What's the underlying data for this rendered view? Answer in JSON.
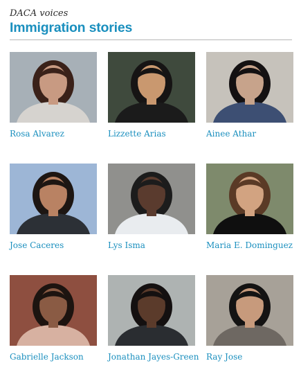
{
  "header": {
    "kicker": "DACA voices",
    "title": "Immigration stories"
  },
  "stories": [
    {
      "name": "Rosa Alvarez",
      "bg": "#a7b0b7",
      "skin": "#c89a82",
      "hair": "#3a2119",
      "shirt": "#d6d3cf"
    },
    {
      "name": "Lizzette Arias",
      "bg": "#3f4a3d",
      "skin": "#c9986f",
      "hair": "#161414",
      "shirt": "#1b1b1b"
    },
    {
      "name": "Ainee Athar",
      "bg": "#c6c2bb",
      "skin": "#c7a38b",
      "hair": "#141112",
      "shirt": "#3d4f73"
    },
    {
      "name": "Jose Caceres",
      "bg": "#9db6d6",
      "skin": "#b98263",
      "hair": "#1d1613",
      "shirt": "#2c3036"
    },
    {
      "name": "Lys Isma",
      "bg": "#90908d",
      "skin": "#5a3b2e",
      "hair": "#1c1c1c",
      "shirt": "#e9ecef"
    },
    {
      "name": "Maria E. Dominguez",
      "bg": "#7e8a6c",
      "skin": "#d2a381",
      "hair": "#5a3a26",
      "shirt": "#0f0f0f"
    },
    {
      "name": "Gabrielle Jackson",
      "bg": "#8e4f40",
      "skin": "#8a5b44",
      "hair": "#1d1410",
      "shirt": "#d7b1a1"
    },
    {
      "name": "Jonathan Jayes-Green",
      "bg": "#aeb3b2",
      "skin": "#5b3b2b",
      "hair": "#141010",
      "shirt": "#2a2d31"
    },
    {
      "name": "Ray Jose",
      "bg": "#a7a198",
      "skin": "#c79a7c",
      "hair": "#141313",
      "shirt": "#6e6862"
    }
  ]
}
